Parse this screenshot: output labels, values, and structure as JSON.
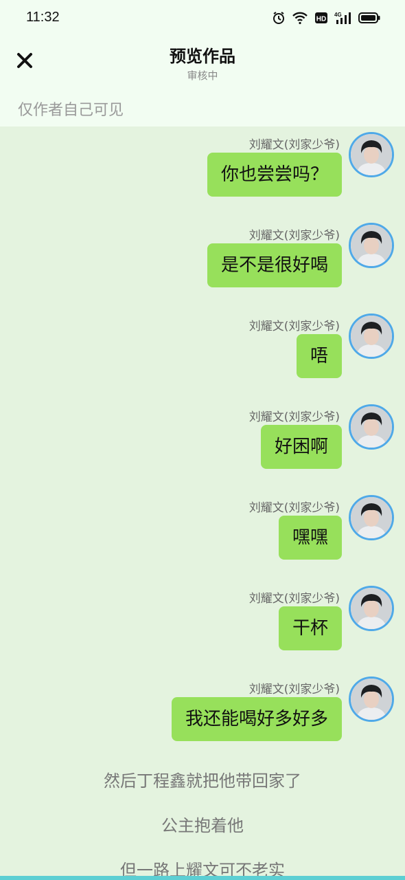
{
  "status_bar": {
    "time": "11:32",
    "icons": [
      "alarm-icon",
      "wifi-icon",
      "hd-icon",
      "signal-4g-icon",
      "battery-icon"
    ],
    "network_label": "4G",
    "hd_label": "HD"
  },
  "header": {
    "close_icon": "close-icon",
    "title": "预览作品",
    "subtitle": "审核中",
    "visibility": "仅作者自己可见"
  },
  "messages": [
    {
      "sender": "刘耀文(刘家少爷)",
      "text": "你也尝尝吗？"
    },
    {
      "sender": "刘耀文(刘家少爷)",
      "text": "是不是很好喝"
    },
    {
      "sender": "刘耀文(刘家少爷)",
      "text": "唔"
    },
    {
      "sender": "刘耀文(刘家少爷)",
      "text": "好困啊"
    },
    {
      "sender": "刘耀文(刘家少爷)",
      "text": "嘿嘿"
    },
    {
      "sender": "刘耀文(刘家少爷)",
      "text": "干杯"
    },
    {
      "sender": "刘耀文(刘家少爷)",
      "text": "我还能喝好多好多"
    }
  ],
  "narration": [
    "然后丁程鑫就把他带回家了",
    "公主抱着他",
    "但一路上耀文可不老实"
  ],
  "colors": {
    "bubble": "#97e05b",
    "background": "#e4f3df",
    "header_bg": "#f2fdf2",
    "avatar_ring": "#4fa9e8"
  }
}
